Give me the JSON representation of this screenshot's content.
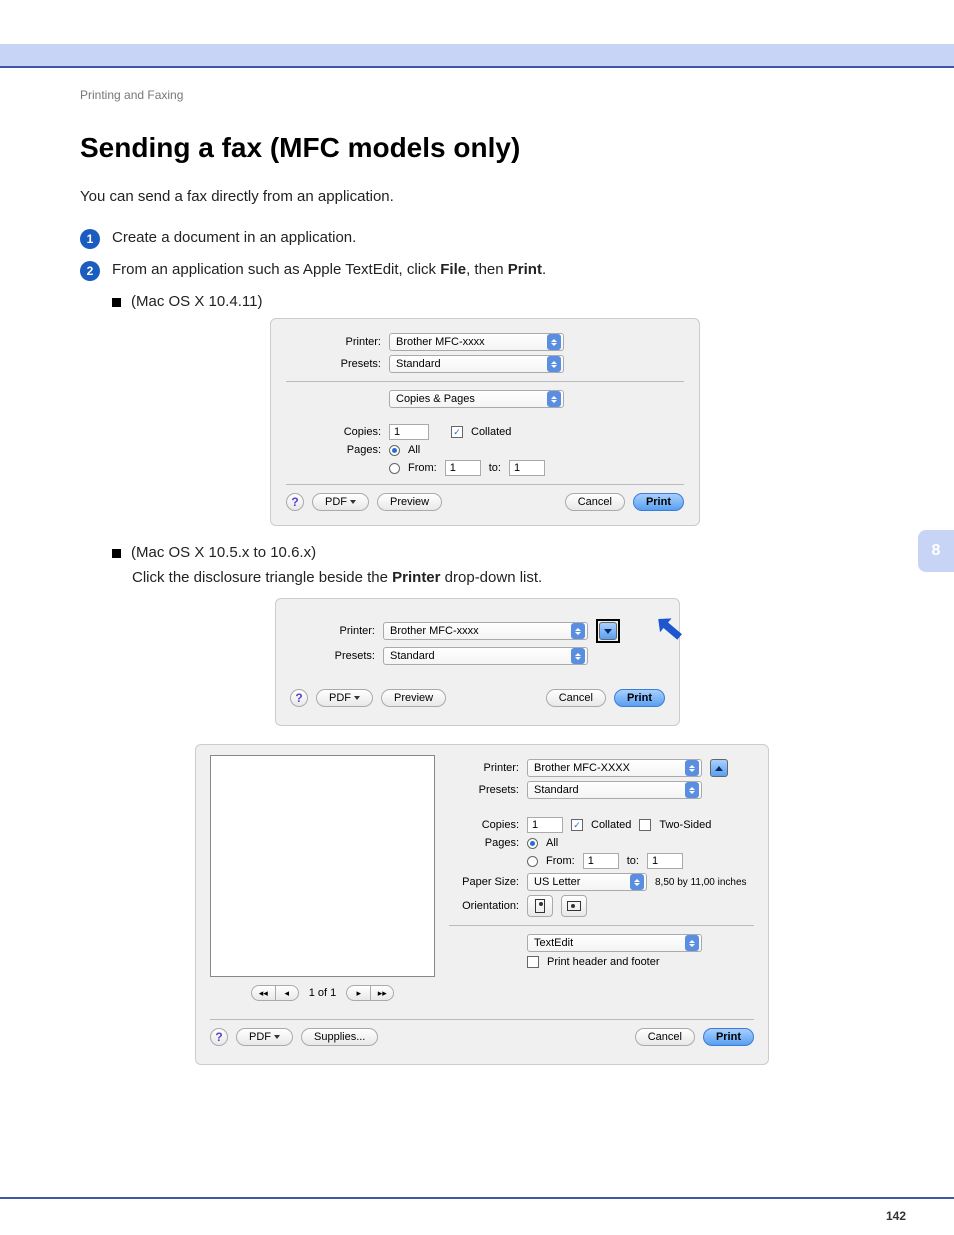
{
  "header": {
    "breadcrumb": "Printing and Faxing",
    "title": "Sending a fax (MFC models only)",
    "intro": "You can send a fax directly from an application.",
    "chapter_tab": "8",
    "page_number": "142"
  },
  "steps": {
    "s1": "Create a document in an application.",
    "s2_prefix": "From an application such as Apple TextEdit, click ",
    "s2_bold1": "File",
    "s2_mid": ", then ",
    "s2_bold2": "Print",
    "s2_suffix": "."
  },
  "bullets": {
    "b1": "(Mac OS X 10.4.11)",
    "b2": "(Mac OS X 10.5.x to 10.6.x)",
    "b2_sub_prefix": "Click the disclosure triangle beside the ",
    "b2_sub_bold": "Printer",
    "b2_sub_suffix": " drop-down list."
  },
  "dialog1": {
    "labels": {
      "printer": "Printer:",
      "presets": "Presets:",
      "copies": "Copies:",
      "pages": "Pages:",
      "from": "From:",
      "to": "to:"
    },
    "values": {
      "printer": "Brother MFC-xxxx",
      "presets": "Standard",
      "section": "Copies & Pages",
      "copies": "1",
      "from": "1",
      "to": "1"
    },
    "options": {
      "collated": "Collated",
      "all": "All"
    },
    "buttons": {
      "help": "?",
      "pdf": "PDF",
      "preview": "Preview",
      "cancel": "Cancel",
      "print": "Print"
    }
  },
  "dialog2": {
    "labels": {
      "printer": "Printer:",
      "presets": "Presets:"
    },
    "values": {
      "printer": "Brother MFC-xxxx",
      "presets": "Standard"
    },
    "buttons": {
      "help": "?",
      "pdf": "PDF",
      "preview": "Preview",
      "cancel": "Cancel",
      "print": "Print"
    }
  },
  "dialog3": {
    "labels": {
      "printer": "Printer:",
      "presets": "Presets:",
      "copies": "Copies:",
      "pages": "Pages:",
      "from": "From:",
      "to": "to:",
      "papersize": "Paper Size:",
      "orientation": "Orientation:"
    },
    "values": {
      "printer": "Brother MFC-XXXX",
      "presets": "Standard",
      "copies": "1",
      "from": "1",
      "to": "1",
      "papersize": "US Letter",
      "papersize_dim": "8,50 by 11,00 inches",
      "section": "TextEdit"
    },
    "options": {
      "collated": "Collated",
      "twosided": "Two-Sided",
      "all": "All",
      "headerfooter": "Print header and footer"
    },
    "nav": {
      "page_of": "1 of 1"
    },
    "buttons": {
      "help": "?",
      "pdf": "PDF",
      "supplies": "Supplies...",
      "cancel": "Cancel",
      "print": "Print"
    }
  }
}
